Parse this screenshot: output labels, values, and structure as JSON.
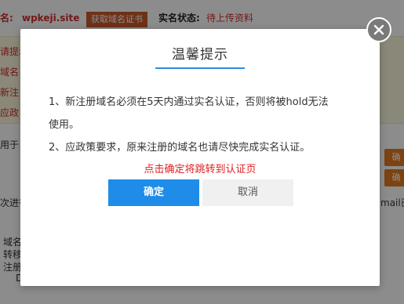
{
  "background": {
    "domain_label": "名:",
    "domain_name": "wpkeji.site",
    "get_certificate_button": "获取域名证书",
    "realname_status_label": "实名状态:",
    "realname_status_value": "待上传资料",
    "notice_lines": [
      "请提示",
      "域名",
      "新注",
      "应政"
    ],
    "side_text_1": "用于",
    "side_text_2": "次进行",
    "side_text_3": "mail已",
    "side_btn_label": "确",
    "bottom_lines": [
      "域名",
      "转移",
      "注册",
      "D"
    ]
  },
  "dialog": {
    "title": "温馨提示",
    "line1": "1、新注册域名必须在5天内通过实名认证，否则将被hold无法",
    "line1_cont": "使用。",
    "line2": "2、应政策要求，原来注册的域名也请尽快完成实名认证。",
    "redirect_hint": "点击确定将跳转到认证页",
    "confirm_label": "确定",
    "cancel_label": "取消"
  },
  "colors": {
    "accent": "#1e8ce8",
    "warning_red": "#e02020",
    "overlay": "rgba(0,0,0,0.45)"
  },
  "icons": {
    "close": "close-icon"
  }
}
